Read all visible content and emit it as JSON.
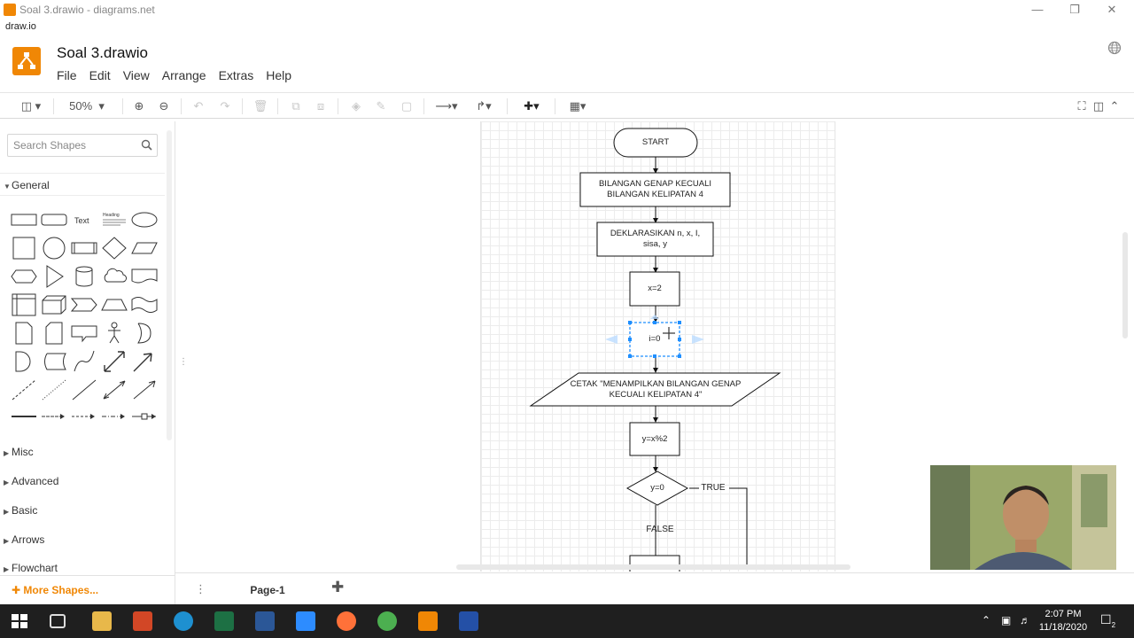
{
  "window": {
    "title": "Soal 3.drawio - diagrams.net",
    "app_label": "draw.io"
  },
  "header": {
    "doc_title": "Soal 3.drawio",
    "menu": [
      "File",
      "Edit",
      "View",
      "Arrange",
      "Extras",
      "Help"
    ]
  },
  "toolbar": {
    "zoom": "50%"
  },
  "sidebar": {
    "search_placeholder": "Search Shapes",
    "categories": {
      "general": "General",
      "misc": "Misc",
      "advanced": "Advanced",
      "basic": "Basic",
      "arrows": "Arrows",
      "flowchart": "Flowchart"
    },
    "shape_text_label": "Text",
    "shape_heading_label": "Heading",
    "more_shapes": "More Shapes..."
  },
  "diagram": {
    "start": "START",
    "title_box": "BILANGAN GENAP KECUALI BILANGAN KELIPATAN 4",
    "declare": "DEKLARASIKAN n, x, I, sisa, y",
    "assign_x": "x=2",
    "assign_i": "i=0",
    "print": "CETAK \"MENAMPILKAN BILANGAN GENAP KECUALI KELIPATAN 4\"",
    "calc_y": "y=x%2",
    "decision": "y=0",
    "true_label": "TRUE",
    "false_label": "FALSE"
  },
  "pages": {
    "active": "Page-1"
  },
  "taskbar": {
    "time": "2:07 PM",
    "date": "11/18/2020",
    "notifications": "2"
  },
  "colors": {
    "brand": "#f08705",
    "selection": "#1f8fff",
    "taskbar": "#1f1f1f"
  }
}
